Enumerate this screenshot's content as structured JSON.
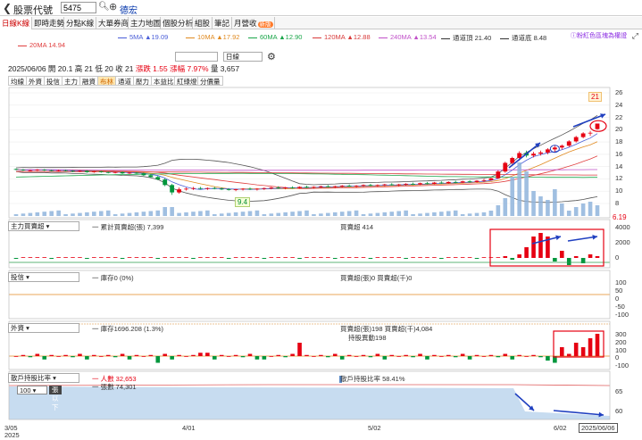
{
  "topbar": {
    "back_icon": "chevron-left-icon",
    "stock_label": "股票代號",
    "stock_code": "5475",
    "stock_name": "德宏"
  },
  "tabs": [
    {
      "label": "日線K線",
      "active": true
    },
    {
      "label": "即時走勢",
      "active": false
    },
    {
      "label": "分點K線",
      "active": false
    },
    {
      "label": "大單券商",
      "active": false
    },
    {
      "label": "主力地圖",
      "active": false
    },
    {
      "label": "個股分析",
      "active": false
    },
    {
      "label": "組股",
      "active": false
    },
    {
      "label": "筆記",
      "active": false
    },
    {
      "label": "月營收",
      "active": false,
      "badge": "新版"
    }
  ],
  "ma_legend": [
    {
      "label": "5MA ▲19.09",
      "color": "#4a5ed8"
    },
    {
      "label": "10MA ▲17.92",
      "color": "#e08a20"
    },
    {
      "label": "60MA ▲12.90",
      "color": "#1aa64a"
    },
    {
      "label": "120MA ▲12.88",
      "color": "#d83a3a"
    },
    {
      "label": "240MA ▲13.54",
      "color": "#c050c8"
    },
    {
      "label": "通道頂 21.40",
      "color": "#333333"
    },
    {
      "label": "通道底 8.48",
      "color": "#333333"
    }
  ],
  "ma_legend2": {
    "label": "20MA 14.94",
    "color": "#e04040"
  },
  "legend_link": "ⓘ粉紅色區塊為權證",
  "info_row": {
    "sel1": "",
    "sel2": "日線"
  },
  "ohlc": {
    "date": "2025/06/06",
    "open": "開 20.1",
    "high": "高 21",
    "low": "低 20",
    "close": "收 21",
    "change": "漲跌 1.55",
    "pct": "漲幅 7.97%",
    "volume": "量 3,657"
  },
  "indicator_tabs": [
    {
      "label": "均線",
      "active": false
    },
    {
      "label": "外資",
      "active": false
    },
    {
      "label": "投信",
      "active": false
    },
    {
      "label": "主力",
      "active": false
    },
    {
      "label": "融資",
      "active": false
    },
    {
      "label": "布林",
      "active": true
    },
    {
      "label": "通道",
      "active": false
    },
    {
      "label": "壓力",
      "active": false
    },
    {
      "label": "本益比",
      "active": false
    },
    {
      "label": "紅綠燈",
      "active": false
    },
    {
      "label": "分價量",
      "active": false
    }
  ],
  "price_axis": [
    "26",
    "24",
    "22",
    "20",
    "18",
    "16",
    "14",
    "12",
    "10",
    "8"
  ],
  "price_marker": "6.19",
  "high_marker": "21",
  "low_marker": "9.4",
  "panels": {
    "main_force": {
      "select": "主力買賣超",
      "cum": "一 累計買賣超(張) 7,399",
      "daily": "買賣超 414",
      "axis": [
        "4000",
        "2000",
        "0"
      ]
    },
    "trust": {
      "select": "投信",
      "hold": "一 庫存0 (0%)",
      "daily": "買賣超(張)0 買賣超(千)0",
      "axis": [
        "100",
        "50",
        "0",
        "-50",
        "-100"
      ]
    },
    "foreign": {
      "select": "外資",
      "hold": "一 庫存1696.208 (1.3%)",
      "daily": "買賣超(張)198 買賣超(千)4,084",
      "daily2": "持股異動198",
      "axis": [
        "300",
        "200",
        "100",
        "0",
        "-100"
      ]
    },
    "holders": {
      "select": "散戶持股比率",
      "people": "一 人數 32,653",
      "shares": "一 張數 74,301",
      "ratio": "散戶持股比率 58.41%",
      "sub_select": "100",
      "sub_btn": "張以下",
      "axis": [
        "65",
        "60"
      ]
    }
  },
  "dates": {
    "start": "3/05",
    "start_year": "2025",
    "d1": "4/01",
    "d2": "5/02",
    "d3": "6/02",
    "end": "2025/06/06"
  },
  "chart_data": {
    "type": "candlestick",
    "note_colors": {
      "up": "#e60012",
      "down": "#00963c"
    },
    "candles": [
      [
        13.6,
        13.7,
        13.4,
        13.5
      ],
      [
        13.5,
        13.6,
        13.3,
        13.4
      ],
      [
        13.4,
        13.5,
        13.2,
        13.4
      ],
      [
        13.4,
        13.6,
        13.3,
        13.5
      ],
      [
        13.5,
        13.6,
        13.3,
        13.4
      ],
      [
        13.4,
        13.5,
        13.2,
        13.3
      ],
      [
        13.3,
        13.5,
        13.2,
        13.4
      ],
      [
        13.4,
        13.5,
        13.2,
        13.3
      ],
      [
        13.3,
        13.4,
        13.1,
        13.2
      ],
      [
        13.2,
        13.4,
        13.1,
        13.3
      ],
      [
        13.3,
        13.4,
        13.0,
        13.1
      ],
      [
        13.1,
        13.3,
        13.0,
        13.2
      ],
      [
        13.2,
        13.3,
        13.0,
        13.1
      ],
      [
        13.1,
        13.2,
        12.9,
        13.0
      ],
      [
        13.0,
        13.2,
        12.9,
        13.1
      ],
      [
        13.1,
        13.2,
        12.8,
        12.9
      ],
      [
        12.9,
        13.1,
        12.8,
        13.0
      ],
      [
        13.0,
        13.1,
        12.8,
        12.9
      ],
      [
        12.9,
        13.0,
        12.5,
        12.6
      ],
      [
        12.6,
        12.8,
        12.2,
        12.3
      ],
      [
        12.3,
        12.5,
        11.8,
        11.9
      ],
      [
        11.9,
        12.1,
        10.8,
        11.0
      ],
      [
        11.0,
        11.2,
        9.4,
        9.8
      ],
      [
        9.8,
        10.6,
        9.6,
        10.3
      ],
      [
        10.3,
        10.6,
        10.1,
        10.4
      ],
      [
        10.4,
        10.7,
        10.2,
        10.5
      ],
      [
        10.5,
        10.7,
        10.3,
        10.4
      ],
      [
        10.4,
        10.6,
        10.2,
        10.5
      ],
      [
        10.5,
        10.7,
        10.3,
        10.4
      ],
      [
        10.4,
        10.6,
        10.2,
        10.3
      ],
      [
        10.3,
        10.5,
        10.1,
        10.2
      ],
      [
        10.2,
        10.4,
        10.0,
        10.3
      ],
      [
        10.3,
        10.5,
        10.1,
        10.4
      ],
      [
        10.4,
        10.6,
        10.2,
        10.3
      ],
      [
        10.3,
        10.5,
        10.1,
        10.4
      ],
      [
        10.4,
        10.6,
        10.2,
        10.5
      ],
      [
        10.5,
        10.7,
        10.3,
        10.6
      ],
      [
        10.6,
        10.8,
        10.4,
        10.5
      ],
      [
        10.5,
        10.7,
        10.3,
        10.6
      ],
      [
        10.6,
        10.8,
        10.4,
        10.5
      ],
      [
        10.5,
        10.8,
        10.4,
        10.7
      ],
      [
        10.7,
        10.9,
        10.5,
        10.6
      ],
      [
        10.6,
        10.8,
        10.4,
        10.7
      ],
      [
        10.7,
        10.9,
        10.5,
        10.8
      ],
      [
        10.8,
        11.0,
        10.6,
        10.7
      ],
      [
        10.7,
        10.9,
        10.5,
        10.8
      ],
      [
        10.8,
        11.0,
        10.6,
        10.9
      ],
      [
        10.9,
        11.1,
        10.7,
        10.8
      ],
      [
        10.8,
        11.0,
        10.6,
        10.9
      ],
      [
        10.9,
        11.1,
        10.7,
        11.0
      ],
      [
        11.0,
        11.2,
        10.8,
        10.9
      ],
      [
        10.9,
        11.1,
        10.7,
        11.0
      ],
      [
        11.0,
        11.2,
        10.8,
        11.1
      ],
      [
        11.1,
        11.3,
        10.9,
        11.0
      ],
      [
        11.0,
        11.2,
        10.8,
        11.1
      ],
      [
        11.1,
        11.3,
        10.9,
        11.2
      ],
      [
        11.2,
        11.4,
        11.0,
        11.1
      ],
      [
        11.1,
        11.4,
        11.0,
        11.3
      ],
      [
        11.3,
        11.5,
        11.1,
        11.2
      ],
      [
        11.2,
        11.5,
        11.1,
        11.4
      ],
      [
        11.4,
        11.6,
        11.2,
        11.3
      ],
      [
        11.3,
        11.6,
        11.2,
        11.5
      ],
      [
        11.5,
        11.7,
        11.3,
        11.4
      ],
      [
        11.4,
        11.7,
        11.3,
        11.6
      ],
      [
        11.6,
        11.8,
        11.4,
        11.5
      ],
      [
        11.5,
        11.8,
        11.4,
        11.7
      ],
      [
        11.7,
        12.0,
        11.5,
        11.8
      ],
      [
        11.8,
        12.2,
        11.7,
        12.1
      ],
      [
        12.1,
        13.4,
        12.0,
        13.2
      ],
      [
        13.2,
        14.8,
        13.0,
        14.6
      ],
      [
        14.6,
        15.6,
        14.2,
        15.4
      ],
      [
        15.4,
        16.5,
        15.0,
        16.2
      ],
      [
        16.2,
        16.6,
        15.5,
        15.8
      ],
      [
        15.8,
        16.4,
        15.5,
        16.1
      ],
      [
        16.1,
        16.6,
        15.8,
        16.3
      ],
      [
        16.3,
        17.0,
        16.0,
        16.8
      ],
      [
        16.8,
        17.4,
        16.4,
        17.1
      ],
      [
        17.1,
        17.6,
        16.8,
        17.4
      ],
      [
        17.4,
        18.3,
        17.2,
        18.1
      ],
      [
        18.1,
        19.0,
        17.9,
        18.8
      ],
      [
        18.8,
        19.6,
        18.6,
        19.4
      ],
      [
        19.4,
        19.8,
        19.0,
        19.5
      ],
      [
        20.1,
        21.0,
        20.0,
        21.0
      ]
    ]
  }
}
